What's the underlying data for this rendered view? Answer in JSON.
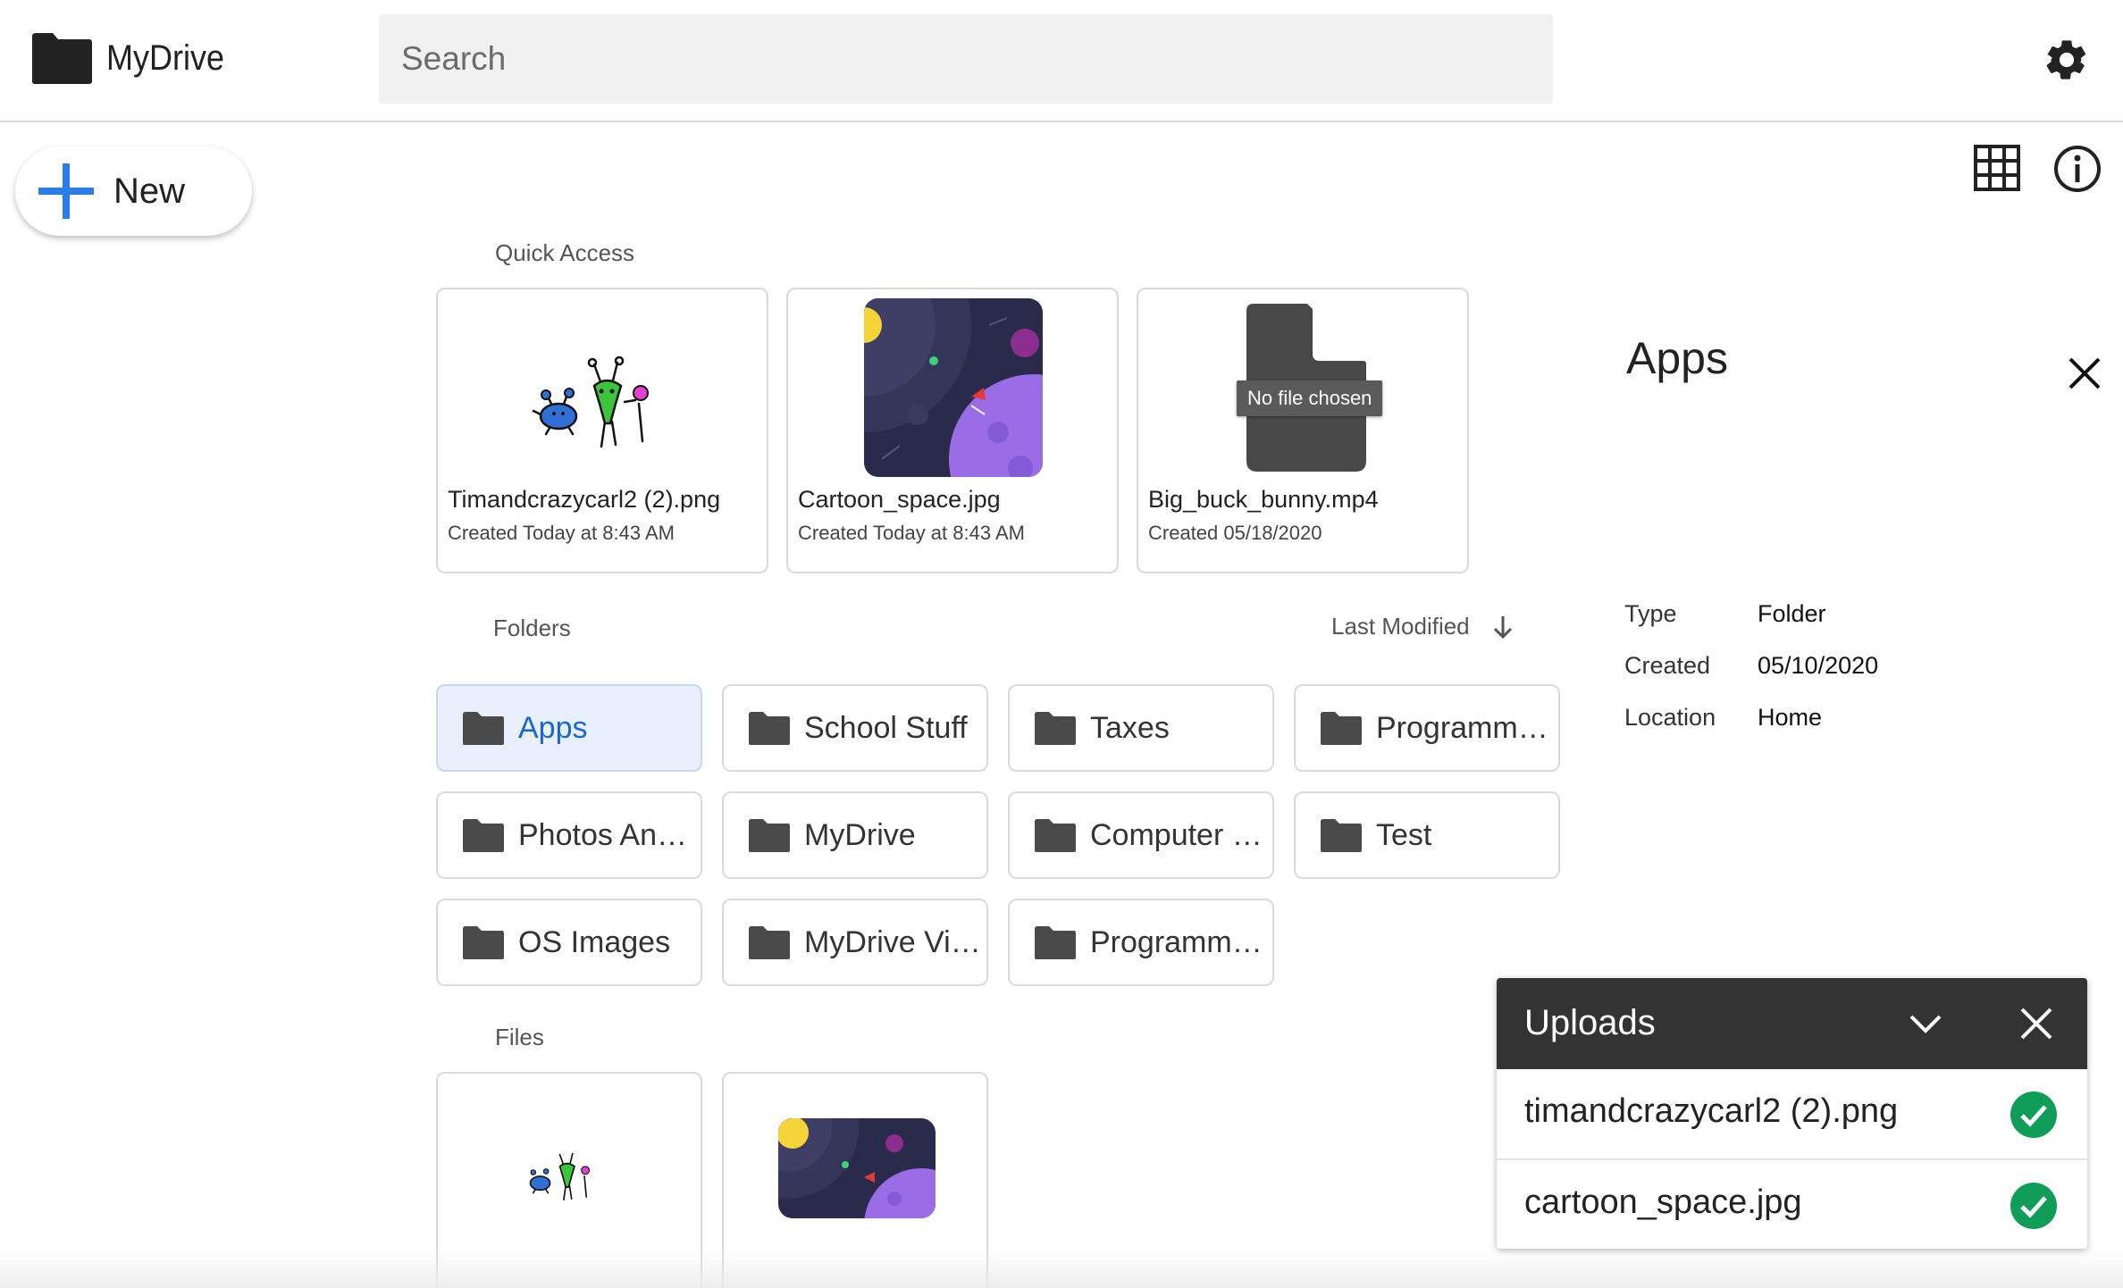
{
  "header": {
    "app_name": "MyDrive",
    "search_placeholder": "Search"
  },
  "new_button": {
    "label": "New"
  },
  "quick_access": {
    "title": "Quick Access",
    "tooltip": "No file chosen",
    "items": [
      {
        "name": "Timandcrazycarl2 (2).png",
        "created": "Created Today at 8:43 AM"
      },
      {
        "name": "Cartoon_space.jpg",
        "created": "Created Today at 8:43 AM"
      },
      {
        "name": "Big_buck_bunny.mp4",
        "created": "Created 05/18/2020"
      }
    ]
  },
  "folders": {
    "title": "Folders",
    "sort_label": "Last Modified",
    "items": [
      {
        "name": "Apps"
      },
      {
        "name": "School Stuff"
      },
      {
        "name": "Taxes"
      },
      {
        "name": "Programmi…"
      },
      {
        "name": "Photos And…"
      },
      {
        "name": "MyDrive"
      },
      {
        "name": "Computer …"
      },
      {
        "name": "Test"
      },
      {
        "name": "OS Images"
      },
      {
        "name": "MyDrive Vid…"
      },
      {
        "name": "Programmi…"
      }
    ]
  },
  "files": {
    "title": "Files"
  },
  "details": {
    "title": "Apps",
    "rows": [
      {
        "label": "Type",
        "value": "Folder"
      },
      {
        "label": "Created",
        "value": "05/10/2020"
      },
      {
        "label": "Location",
        "value": "Home"
      }
    ]
  },
  "uploads": {
    "title": "Uploads",
    "items": [
      {
        "name": "timandcrazycarl2 (2).png"
      },
      {
        "name": "cartoon_space.jpg"
      }
    ]
  },
  "colors": {
    "accent_blue": "#1a67d2",
    "selected_bg": "#e8f0fe",
    "upload_header": "#333333",
    "success_green": "#0f9d58",
    "folder_gray": "#4a4a4a"
  }
}
